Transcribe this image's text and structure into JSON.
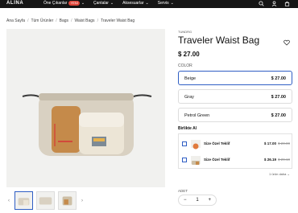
{
  "header": {
    "logo": "ALİNA",
    "nav": [
      {
        "label": "Öne Çıkanlar",
        "badge": "YENİ",
        "chevron": true
      },
      {
        "label": "Çantalar",
        "chevron": true
      },
      {
        "label": "Aksesuarlar",
        "chevron": true
      },
      {
        "label": "Servis",
        "chevron": true
      }
    ],
    "icons": [
      "search-icon",
      "user-icon",
      "bag-icon"
    ]
  },
  "breadcrumb": [
    "Ana Sayfa",
    "Tüm Ürünler",
    "Bags",
    "Waist Bags",
    "Traveler Waist Bag"
  ],
  "product": {
    "brand": "TUNDRG",
    "title": "Traveler Waist Bag",
    "price": "$ 27.00",
    "color_label": "COLOR",
    "colors": [
      {
        "name": "Beige",
        "price": "$ 27.00",
        "selected": true
      },
      {
        "name": "Gray",
        "price": "$ 27.00",
        "selected": false
      },
      {
        "name": "Petrol Green",
        "price": "$ 27.00",
        "selected": false
      }
    ]
  },
  "bundle": {
    "label": "Birlikte Al",
    "items": [
      {
        "name": "Size Özel Teklif",
        "price": "$ 17.00",
        "old_price": "$ 20.00"
      },
      {
        "name": "Size Özel Teklif",
        "price": "$ 26.19",
        "old_price": "$ 29.10"
      }
    ],
    "more_label": "1 ürün daha ⌄"
  },
  "quantity": {
    "label": "ADET",
    "value": "1",
    "minus": "−",
    "plus": "+"
  },
  "colors": {
    "accent": "#2f5ec4",
    "badge": "#e0473b",
    "topbar": "#151515"
  }
}
